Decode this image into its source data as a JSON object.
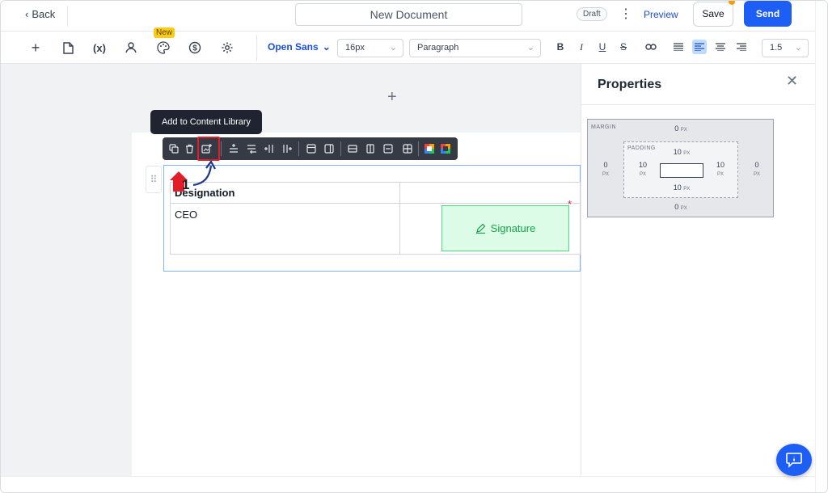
{
  "header": {
    "back_label": "Back",
    "document_title": "New Document",
    "status_badge": "Draft",
    "preview_label": "Preview",
    "save_label": "Save",
    "send_label": "Send"
  },
  "toolbar": {
    "variables_label": "(x)",
    "new_badge": "New",
    "font_family": "Open Sans",
    "font_size": "16px",
    "block_type": "Paragraph",
    "line_height": "1.5"
  },
  "canvas": {
    "tooltip": "Add to Content Library",
    "step_number": "1",
    "table": {
      "headers": [
        "Designation",
        ""
      ],
      "rows": [
        [
          "CEO",
          ""
        ]
      ]
    },
    "signature_label": "Signature",
    "required_marker": "*"
  },
  "properties": {
    "title": "Properties",
    "margin_label": "MARGIN",
    "padding_label": "PADDING",
    "margin": {
      "top": "0",
      "right": "0",
      "bottom": "0",
      "left": "0"
    },
    "padding": {
      "top": "10",
      "right": "10",
      "bottom": "10",
      "left": "10"
    },
    "unit": "PX"
  },
  "colors": {
    "accent": "#1d5ef5",
    "signature_bg": "#dcfce7",
    "signature_text": "#16a34a",
    "annotation_red": "#e11d2a"
  }
}
